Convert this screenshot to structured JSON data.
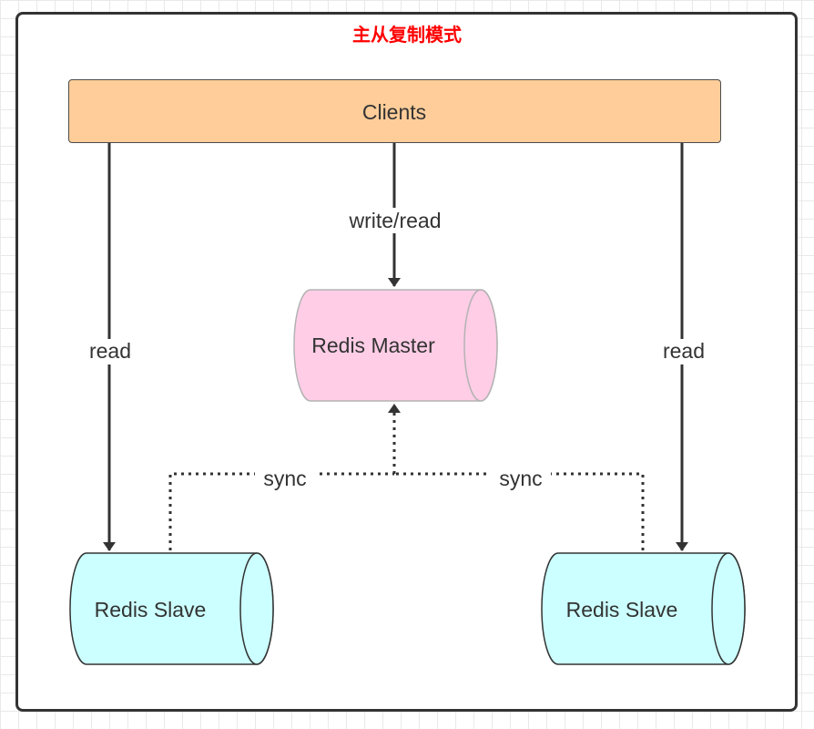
{
  "diagram": {
    "title": "主从复制模式",
    "nodes": {
      "clients": "Clients",
      "master": "Redis Master",
      "slave_left": "Redis Slave",
      "slave_right": "Redis Slave"
    },
    "edges": {
      "write_read": "write/read",
      "read_left": "read",
      "read_right": "read",
      "sync_left": "sync",
      "sync_right": "sync"
    },
    "colors": {
      "clients_fill": "#fecd99",
      "master_fill": "#ffcde6",
      "slave_fill": "#ccffff",
      "title": "#ff0000",
      "lines": "#333333"
    }
  }
}
